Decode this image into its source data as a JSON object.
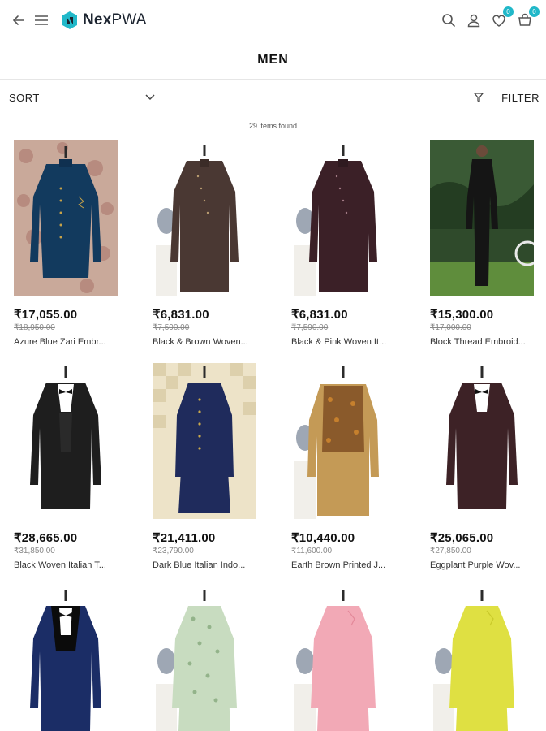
{
  "header": {
    "logo_bold": "Nex",
    "logo_light": "PWA",
    "wishlist_count": "0",
    "cart_count": "0",
    "icons": [
      "back-arrow-icon",
      "hamburger-menu-icon",
      "search-icon",
      "user-icon",
      "heart-icon",
      "cart-icon"
    ]
  },
  "page": {
    "title": "MEN",
    "sort_label": "SORT",
    "filter_label": "FILTER",
    "items_found": "29 items found"
  },
  "colors": {
    "accent": "#21b8c9",
    "text": "#111111",
    "divider": "#e6e6e6"
  },
  "products": [
    {
      "price": "₹17,055.00",
      "old_price": "₹18,950.00",
      "name": "Azure Blue Zari Embr..."
    },
    {
      "price": "₹6,831.00",
      "old_price": "₹7,590.00",
      "name": "Black & Brown Woven..."
    },
    {
      "price": "₹6,831.00",
      "old_price": "₹7,590.00",
      "name": "Black & Pink Woven It..."
    },
    {
      "price": "₹15,300.00",
      "old_price": "₹17,000.00",
      "name": "Block Thread Embroid..."
    },
    {
      "price": "₹28,665.00",
      "old_price": "₹31,850.00",
      "name": "Black Woven Italian T..."
    },
    {
      "price": "₹21,411.00",
      "old_price": "₹23,790.00",
      "name": "Dark Blue Italian Indo..."
    },
    {
      "price": "₹10,440.00",
      "old_price": "₹11,600.00",
      "name": "Earth Brown Printed J..."
    },
    {
      "price": "₹25,065.00",
      "old_price": "₹27,850.00",
      "name": "Eggplant Purple Wov..."
    },
    {
      "price": "",
      "old_price": "",
      "name": ""
    },
    {
      "price": "",
      "old_price": "",
      "name": ""
    },
    {
      "price": "",
      "old_price": "",
      "name": ""
    },
    {
      "price": "",
      "old_price": "",
      "name": ""
    }
  ]
}
